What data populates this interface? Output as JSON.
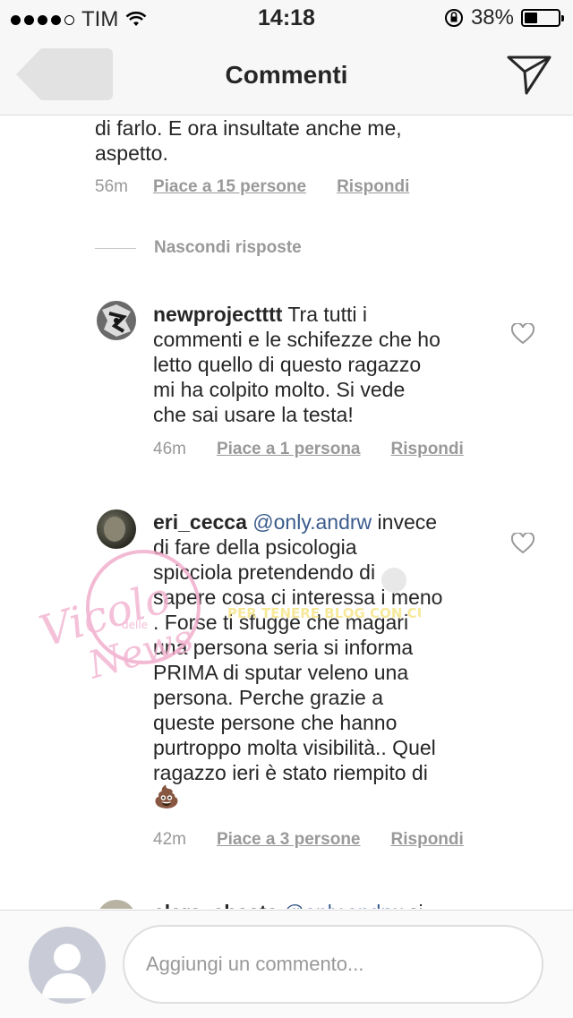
{
  "status": {
    "carrier": "TIM",
    "time": "14:18",
    "battery_pct": "38%",
    "battery_level": 0.38
  },
  "nav": {
    "title": "Commenti"
  },
  "comments": [
    {
      "text_lines": [
        "di farlo. E ora insultate anche me,",
        "aspetto."
      ],
      "time": "56m",
      "likes": "Piace a 15 persone",
      "reply": "Rispondi"
    },
    {
      "username": "newprojectttt",
      "text_lines": [
        " Tra tutti i",
        "commenti e le schifezze che ho",
        "letto quello di questo ragazzo",
        "mi ha colpito molto. Si vede",
        "che sai usare la testa!"
      ],
      "time": "46m",
      "likes": "Piace a 1 persona",
      "reply": "Rispondi"
    },
    {
      "username": "eri_cecca",
      "mention": "@only.andrw",
      "text_lines": [
        " invece",
        "di fare della psicologia",
        "spicciola pretendendo di",
        "sapere cosa ci interessa i meno",
        ". Forse ti sfugge che magari",
        "una persona seria si informa",
        "PRIMA di sputar veleno una",
        "persona. Perche grazie a",
        "queste persone che hanno",
        "purtroppo molta visibilità.. Quel",
        "ragazzo ieri è stato riempito di"
      ],
      "emoji": "💩",
      "time": "42m",
      "likes": "Piace a 3 persone",
      "reply": "Rispondi"
    },
    {
      "username": "clara_sbasta",
      "mention": "@only.andrw",
      "text_lines": [
        " si"
      ]
    }
  ],
  "replies": {
    "hide_label": "Nascondi risposte"
  },
  "watermark": {
    "line1": "Vicolo",
    "line2": "delle",
    "line3": "News",
    "overlay": "PER TENERE BLOG CON CURA"
  },
  "composer": {
    "placeholder": "Aggiungi un commento..."
  },
  "icons": {
    "back": "back-chevron-icon",
    "send": "paper-plane-icon",
    "like": "heart-outline-icon",
    "wifi": "wifi-icon",
    "lock": "rotation-lock-icon"
  }
}
